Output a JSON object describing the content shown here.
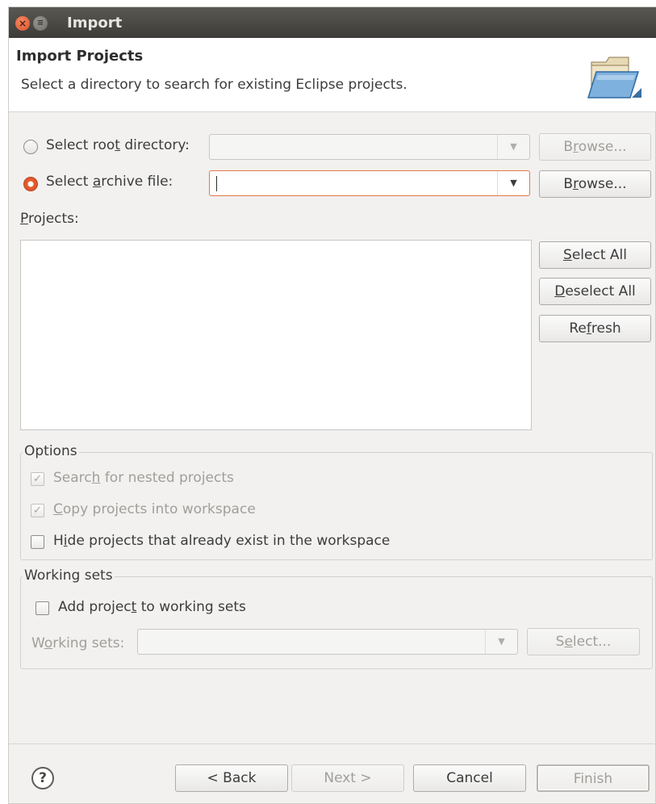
{
  "window": {
    "title": "Import"
  },
  "header": {
    "title": "Import Projects",
    "description": "Select a directory to search for existing Eclipse projects."
  },
  "source": {
    "root_dir_label_pre": "Select roo",
    "root_dir_label_ul": "t",
    "root_dir_label_post": " directory:",
    "archive_label_pre": "Select ",
    "archive_label_ul": "a",
    "archive_label_post": "rchive file:",
    "browse_root_pre": "B",
    "browse_root_ul": "r",
    "browse_root_post": "owse...",
    "browse_archive_pre": "B",
    "browse_archive_ul": "r",
    "browse_archive_post": "owse...",
    "selected": "archive"
  },
  "projects": {
    "label_ul": "P",
    "label_post": "rojects:",
    "select_all_ul": "S",
    "select_all_post": "elect All",
    "deselect_all_ul": "D",
    "deselect_all_post": "eselect All",
    "refresh_pre": "Re",
    "refresh_ul": "f",
    "refresh_post": "resh"
  },
  "options": {
    "title": "Options",
    "nested_pre": "Searc",
    "nested_ul": "h",
    "nested_post": " for nested projects",
    "copy_ul": "C",
    "copy_post": "opy projects into workspace",
    "hide_pre": "H",
    "hide_ul": "i",
    "hide_post": "de projects that already exist in the workspace"
  },
  "working_sets": {
    "title": "Working sets",
    "add_pre": "Add projec",
    "add_ul": "t",
    "add_post": " to working sets",
    "label_pre": "W",
    "label_ul": "o",
    "label_post": "rking sets:",
    "select_pre": "S",
    "select_ul": "e",
    "select_post": "lect..."
  },
  "footer": {
    "help_glyph": "?",
    "back": "< Back",
    "next": "Next >",
    "cancel": "Cancel",
    "finish": "Finish"
  },
  "icons": {
    "check_glyph": "✓",
    "combo_arrow": "▼"
  }
}
